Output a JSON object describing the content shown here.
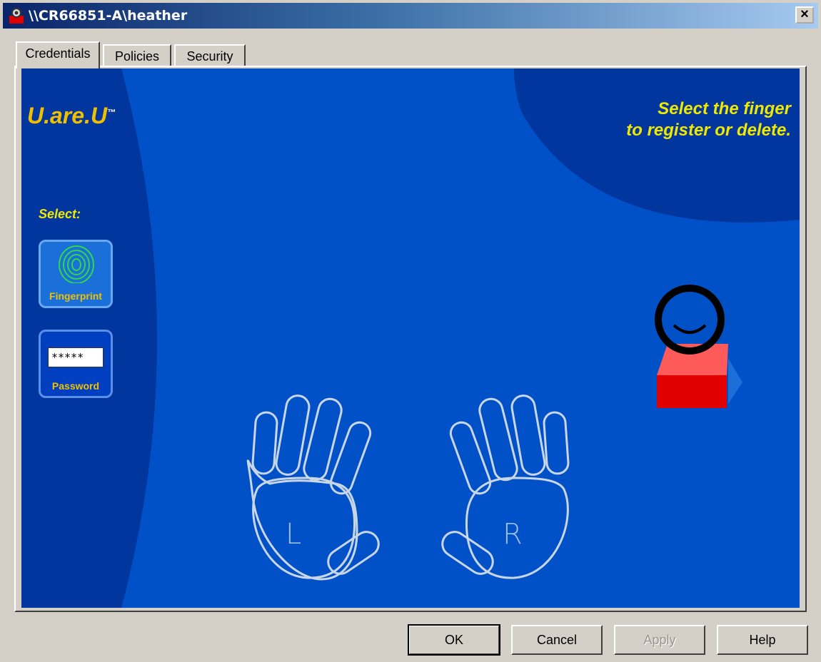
{
  "window": {
    "title": "\\\\CR66851-A\\heather",
    "close_label": "×"
  },
  "tabs": [
    {
      "label": "Credentials",
      "active": true
    },
    {
      "label": "Policies",
      "active": false
    },
    {
      "label": "Security",
      "active": false
    }
  ],
  "panel": {
    "brand": "U.are.U",
    "prompt_line1": "Select the finger",
    "prompt_line2": "to register or delete.",
    "select_label": "Select:",
    "fingerprint_button": {
      "label": "Fingerprint"
    },
    "password_button": {
      "label": "Password",
      "mask": "*****"
    },
    "left_hand_letter": "L",
    "right_hand_letter": "R"
  },
  "buttons": {
    "ok": "OK",
    "cancel": "Cancel",
    "apply": "Apply",
    "help": "Help"
  },
  "colors": {
    "stage_blue": "#0050c8",
    "dark_blue": "#00369e",
    "accent_yellow": "#f0e800",
    "outline": "#c8d6e6"
  }
}
